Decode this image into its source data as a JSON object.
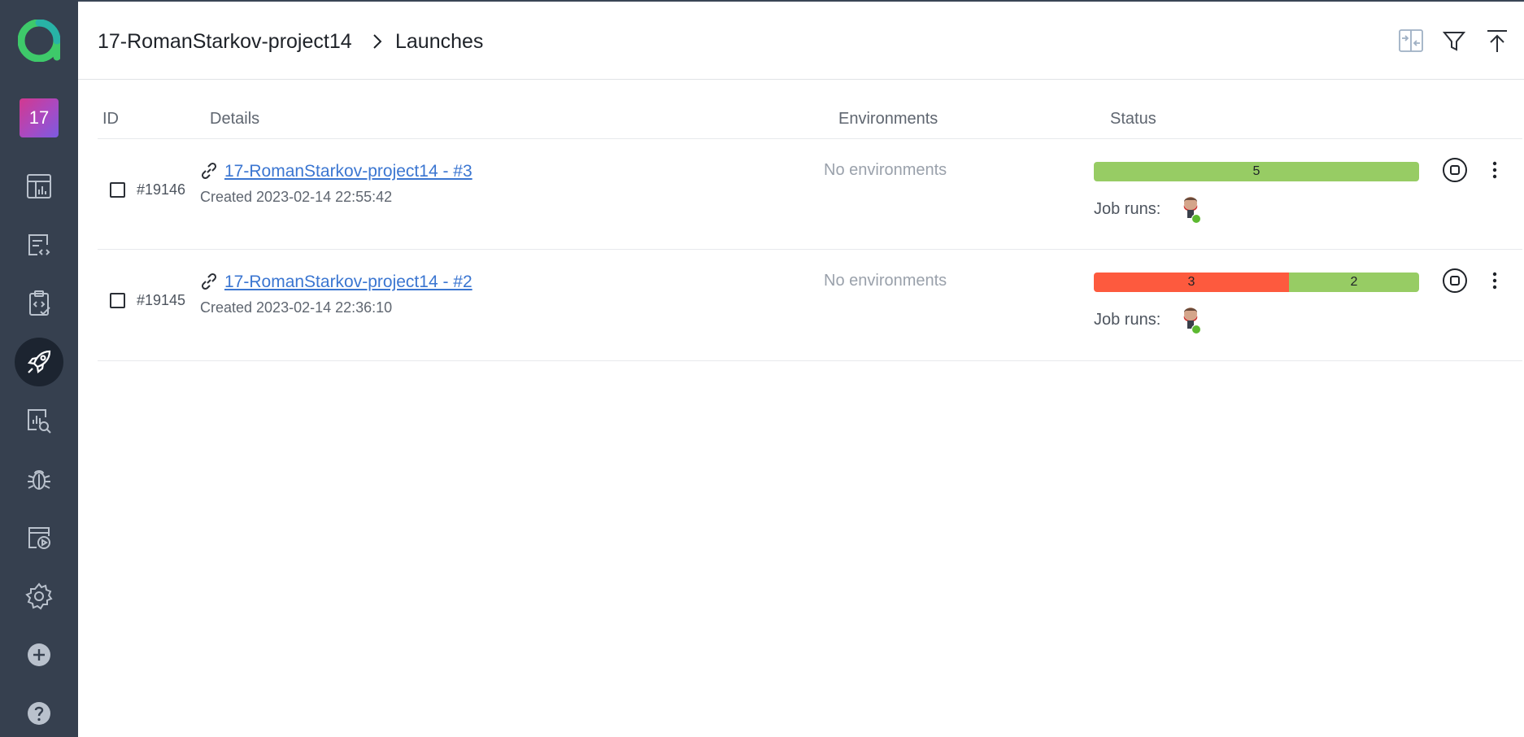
{
  "colors": {
    "sidebar_bg": "#36404f",
    "sidebar_active": "#1c2430",
    "link": "#3b76d1",
    "status_passed": "#97cc64",
    "status_failed": "#fd5a3e",
    "online_dot": "#5cb930"
  },
  "sidebar": {
    "logo_icon": "allure-logo-icon",
    "project_badge": "17",
    "items": [
      {
        "icon": "dashboard-icon",
        "active": false
      },
      {
        "icon": "test-results-icon",
        "active": false
      },
      {
        "icon": "test-cases-icon",
        "active": false
      },
      {
        "icon": "launches-rocket-icon",
        "active": true
      },
      {
        "icon": "analytics-icon",
        "active": false
      },
      {
        "icon": "defects-bug-icon",
        "active": false
      },
      {
        "icon": "jobs-icon",
        "active": false
      },
      {
        "icon": "settings-gear-icon",
        "active": false
      },
      {
        "icon": "add-plus-icon",
        "active": false
      },
      {
        "icon": "help-question-icon",
        "active": false
      }
    ]
  },
  "header": {
    "project": "17-RomanStarkov-project14",
    "current": "Launches",
    "actions": [
      "compare-icon",
      "filter-icon",
      "upload-icon"
    ]
  },
  "table": {
    "columns": {
      "id": "ID",
      "details": "Details",
      "environments": "Environments",
      "status": "Status"
    },
    "rows": [
      {
        "id": "#19146",
        "name": "17-RomanStarkov-project14 - #3",
        "created": "Created 2023-02-14 22:55:42",
        "environments": "No environments",
        "status": [
          {
            "label": "5",
            "kind": "passed",
            "count": 5
          }
        ],
        "job_runs_label": "Job runs:"
      },
      {
        "id": "#19145",
        "name": "17-RomanStarkov-project14 - #2",
        "created": "Created 2023-02-14 22:36:10",
        "environments": "No environments",
        "status": [
          {
            "label": "3",
            "kind": "failed",
            "count": 3
          },
          {
            "label": "2",
            "kind": "passed",
            "count": 2
          }
        ],
        "job_runs_label": "Job runs:"
      }
    ]
  }
}
